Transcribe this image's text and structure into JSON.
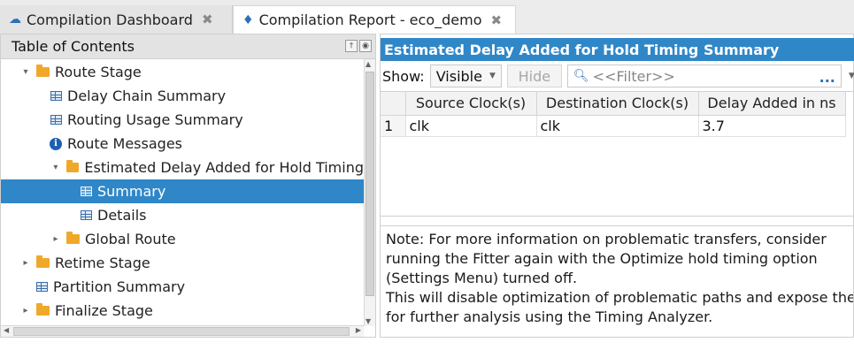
{
  "tabs": [
    {
      "label": "Compilation Dashboard",
      "icon": "dashboard-icon",
      "active": false
    },
    {
      "label": "Compilation Report - eco_demo",
      "icon": "report-icon",
      "active": true
    }
  ],
  "toc": {
    "title": "Table of Contents",
    "items": [
      {
        "label": "Route Stage",
        "icon": "folder-icon",
        "expanded": true
      },
      {
        "label": "Delay Chain Summary",
        "icon": "table-icon"
      },
      {
        "label": "Routing Usage Summary",
        "icon": "table-icon"
      },
      {
        "label": "Route Messages",
        "icon": "info-icon"
      },
      {
        "label": "Estimated Delay Added for Hold Timing",
        "icon": "folder-icon",
        "expanded": true
      },
      {
        "label": "Summary",
        "icon": "table-icon",
        "selected": true
      },
      {
        "label": "Details",
        "icon": "table-icon"
      },
      {
        "label": "Global Route",
        "icon": "folder-icon",
        "expanded": false
      },
      {
        "label": "Retime Stage",
        "icon": "folder-icon",
        "expanded": false
      },
      {
        "label": "Partition Summary",
        "icon": "table-icon"
      },
      {
        "label": "Finalize Stage",
        "icon": "folder-icon",
        "expanded": false
      }
    ]
  },
  "report": {
    "title": "Estimated Delay Added for Hold Timing Summary",
    "show_label": "Show:",
    "show_value": "Visible",
    "hide_label": "Hide",
    "filter_placeholder": "<<Filter>>",
    "filter_more": "...",
    "columns": [
      "Source Clock(s)",
      "Destination Clock(s)",
      "Delay Added in ns"
    ],
    "rows": [
      {
        "index": "1",
        "cells": [
          "clk",
          "clk",
          "3.7"
        ]
      }
    ],
    "note_lines": [
      "Note: For more information on problematic transfers, consider",
      "running the Fitter again with the Optimize hold timing option",
      "(Settings Menu) turned off.",
      "This will disable optimization of problematic paths and expose them",
      "for further analysis using the Timing Analyzer."
    ]
  },
  "colors": {
    "accent": "#2f87c8",
    "folder": "#f0a82a"
  }
}
